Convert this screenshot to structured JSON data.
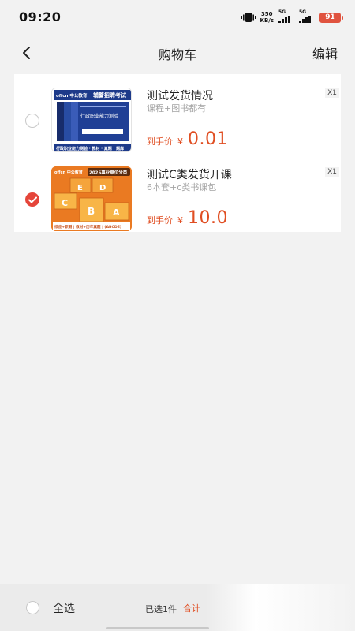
{
  "status_bar": {
    "time": "09:20",
    "net_speed_value": "350",
    "net_speed_unit": "KB/s",
    "signal1_label": "5G",
    "signal2_label": "5G",
    "battery": "91",
    "vibrate_icon": "vibrate-icon",
    "battery_color": "#e0533f"
  },
  "nav": {
    "back_icon": "chevron-left-icon",
    "title": "购物车",
    "edit_label": "编辑"
  },
  "cart_items": [
    {
      "title": "测试发货情况",
      "subtitle": "课程+图书都有",
      "quantity": "X1",
      "price_label": "到手价",
      "currency": "¥",
      "price": "0.01",
      "checked": false,
      "thumb": {
        "brand": "offcn 中公教育",
        "banner": "辅警招聘考试",
        "book_title": "行政职业能力测验",
        "footer": "行政职业能力测验 · 教材 · 真题 · 题库"
      }
    },
    {
      "title": "测试C类发货开课",
      "subtitle": "6本套+c类书课包",
      "quantity": "X1",
      "price_label": "到手价",
      "currency": "¥",
      "price": "10.0",
      "checked": true,
      "thumb": {
        "brand": "offcn 中公教育",
        "banner": "2025事业单位分类",
        "letters": [
          "E",
          "D",
          "C",
          "B",
          "A"
        ],
        "footer": "综应+职测 | 教材+历年真题 | (ABCDE)"
      }
    }
  ],
  "bottom_bar": {
    "select_all_label": "全选",
    "selected_count": "已选1件",
    "total_label": "合计"
  },
  "colors": {
    "accent": "#e04e22",
    "checked": "#e5453a",
    "background": "#f2f2f2"
  }
}
